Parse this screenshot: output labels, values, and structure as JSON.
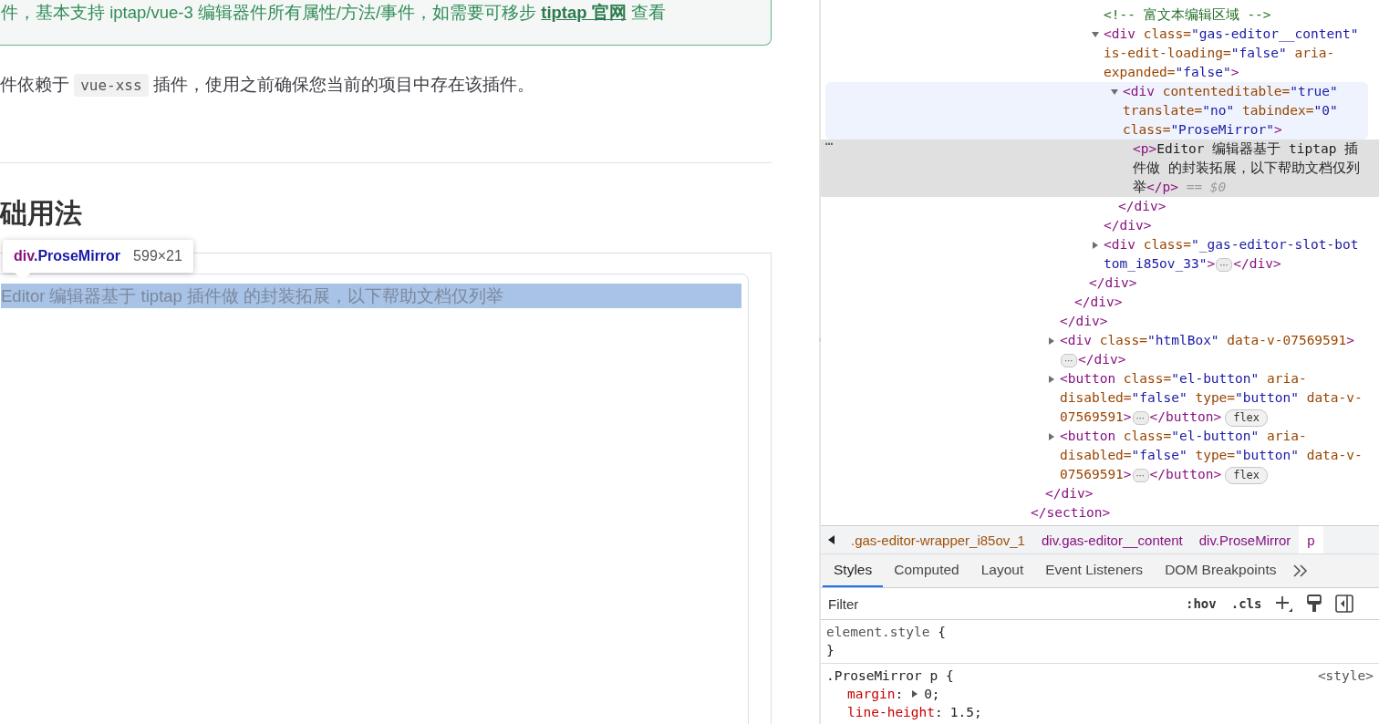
{
  "page": {
    "tip": {
      "text": "件，基本支持 iptap/vue-3 编辑器件所有属性/方法/事件，如需要可移步 ",
      "link": "tiptap 官网",
      "after": " 查看"
    },
    "notice": {
      "before": "件依赖于 ",
      "code": "vue-xss",
      "after": " 插件，使用之前确保您当前的项目中存在该插件。"
    },
    "heading": "础用法",
    "tooltip": {
      "tag": "div",
      "selector": ".ProseMirror",
      "size": "599×21"
    },
    "editor_text": "Editor 编辑器基于 tiptap 插件做 的封装拓展，以下帮助文档仅列举"
  },
  "elements": {
    "close": [
      {
        "kind": "tag",
        "text": "</section>"
      }
    ],
    "children": [
      {
        "close": [
          {
            "kind": "tag",
            "text": "</div>"
          }
        ],
        "children": [
          {
            "close": [
              {
                "kind": "tag",
                "text": "</div>"
              }
            ],
            "children": [
              {
                "close": [
                  {
                    "kind": "tag",
                    "text": "</div>"
                  }
                ],
                "children": [
                  {
                    "close": [
                      {
                        "kind": "tag",
                        "text": "</div>"
                      }
                    ],
                    "children": [
                      {
                        "selected": false,
                        "lines": [
                          [
                            {
                              "kind": "comment",
                              "text": "<!-- 富文本编辑区域 -->"
                            }
                          ]
                        ]
                      },
                      {
                        "expanded": true,
                        "selected": false,
                        "lines": [
                          [
                            {
                              "kind": "tag",
                              "text": "<div"
                            },
                            {
                              "kind": "attr",
                              "text": " class="
                            },
                            {
                              "kind": "value",
                              "text": "\"gas-editor__content\""
                            }
                          ],
                          [
                            {
                              "kind": "attr",
                              "text": "is-edit-loading="
                            },
                            {
                              "kind": "value",
                              "text": "\"false\""
                            },
                            {
                              "kind": "attr",
                              "text": " aria-"
                            }
                          ],
                          [
                            {
                              "kind": "attr",
                              "text": "expanded="
                            },
                            {
                              "kind": "value",
                              "text": "\"false\""
                            },
                            {
                              "kind": "tag",
                              "text": ">"
                            }
                          ]
                        ],
                        "children": [
                          {
                            "expanded": true,
                            "selected": false,
                            "hovered": true,
                            "lines": [
                              [
                                {
                                  "kind": "tag",
                                  "text": "<div"
                                },
                                {
                                  "kind": "attr",
                                  "text": " contenteditable="
                                },
                                {
                                  "kind": "value",
                                  "text": "\"true\""
                                }
                              ],
                              [
                                {
                                  "kind": "attr",
                                  "text": "translate="
                                },
                                {
                                  "kind": "value",
                                  "text": "\"no\""
                                },
                                {
                                  "kind": "attr",
                                  "text": " tabindex="
                                },
                                {
                                  "kind": "value",
                                  "text": "\"0\""
                                }
                              ],
                              [
                                {
                                  "kind": "attr",
                                  "text": "class="
                                },
                                {
                                  "kind": "value",
                                  "text": "\"ProseMirror\""
                                },
                                {
                                  "kind": "tag",
                                  "text": ">"
                                }
                              ]
                            ],
                            "children": [
                              {
                                "selected": true,
                                "more": "⋯",
                                "lines": [
                                  [
                                    {
                                      "kind": "tag",
                                      "text": "<p>"
                                    },
                                    {
                                      "kind": "text",
                                      "text": "Editor 编辑器基于 tiptap 插"
                                    }
                                  ],
                                  [
                                    {
                                      "kind": "text",
                                      "text": "件做 的封装拓展，以下帮助文档仅列"
                                    }
                                  ],
                                  [
                                    {
                                      "kind": "text",
                                      "text": "举"
                                    },
                                    {
                                      "kind": "tag",
                                      "text": "</p>"
                                    },
                                    {
                                      "kind": "eq",
                                      "text": " == $0"
                                    }
                                  ]
                                ]
                              }
                            ],
                            "close": [
                              {
                                "kind": "tag",
                                "text": "</div>"
                              }
                            ]
                          }
                        ],
                        "close": [
                          {
                            "kind": "tag",
                            "text": "</div>"
                          }
                        ]
                      },
                      {
                        "expanded": false,
                        "selected": false,
                        "lines": [
                          [
                            {
                              "kind": "tag",
                              "text": "<div"
                            },
                            {
                              "kind": "attr",
                              "text": " class="
                            },
                            {
                              "kind": "value",
                              "text": "\"_gas-editor-slot-bot"
                            }
                          ],
                          [
                            {
                              "kind": "value",
                              "text": "tom_i85ov_33\""
                            },
                            {
                              "kind": "tag",
                              "text": ">"
                            },
                            {
                              "kind": "ellipsis",
                              "text": "⋯"
                            },
                            {
                              "kind": "tag",
                              "text": "</div>"
                            }
                          ]
                        ]
                      }
                    ]
                  }
                ]
              }
            ]
          },
          {
            "expanded": false,
            "selected": false,
            "lines": [
              [
                {
                  "kind": "tag",
                  "text": "<div"
                },
                {
                  "kind": "attr",
                  "text": " class="
                },
                {
                  "kind": "value",
                  "text": "\"htmlBox\""
                },
                {
                  "kind": "attr",
                  "text": " data-v-07569591"
                },
                {
                  "kind": "tag",
                  "text": ">"
                }
              ],
              [
                {
                  "kind": "ellipsis",
                  "text": "⋯"
                },
                {
                  "kind": "tag",
                  "text": "</div>"
                }
              ]
            ]
          },
          {
            "expanded": false,
            "selected": false,
            "lines": [
              [
                {
                  "kind": "tag",
                  "text": "<button"
                },
                {
                  "kind": "attr",
                  "text": " class="
                },
                {
                  "kind": "value",
                  "text": "\"el-button\""
                },
                {
                  "kind": "attr",
                  "text": " aria-"
                }
              ],
              [
                {
                  "kind": "attr",
                  "text": "disabled="
                },
                {
                  "kind": "value",
                  "text": "\"false\""
                },
                {
                  "kind": "attr",
                  "text": " type="
                },
                {
                  "kind": "value",
                  "text": "\"button\""
                },
                {
                  "kind": "attr",
                  "text": " data-v-"
                }
              ],
              [
                {
                  "kind": "attr",
                  "text": "07569591"
                },
                {
                  "kind": "tag",
                  "text": ">"
                },
                {
                  "kind": "ellipsis",
                  "text": "⋯"
                },
                {
                  "kind": "tag",
                  "text": "</button>"
                },
                {
                  "kind": "badge",
                  "text": "flex"
                }
              ]
            ]
          },
          {
            "expanded": false,
            "selected": false,
            "lines": [
              [
                {
                  "kind": "tag",
                  "text": "<button"
                },
                {
                  "kind": "attr",
                  "text": " class="
                },
                {
                  "kind": "value",
                  "text": "\"el-button\""
                },
                {
                  "kind": "attr",
                  "text": " aria-"
                }
              ],
              [
                {
                  "kind": "attr",
                  "text": "disabled="
                },
                {
                  "kind": "value",
                  "text": "\"false\""
                },
                {
                  "kind": "attr",
                  "text": " type="
                },
                {
                  "kind": "value",
                  "text": "\"button\""
                },
                {
                  "kind": "attr",
                  "text": " data-v-"
                }
              ],
              [
                {
                  "kind": "attr",
                  "text": "07569591"
                },
                {
                  "kind": "tag",
                  "text": ">"
                },
                {
                  "kind": "ellipsis",
                  "text": "⋯"
                },
                {
                  "kind": "tag",
                  "text": "</button>"
                },
                {
                  "kind": "badge",
                  "text": "flex"
                }
              ]
            ]
          }
        ]
      }
    ]
  },
  "breadcrumbs": [
    {
      "label": ".gas-editor-wrapper_i85ov_1",
      "color": "#a0520d",
      "selected": false
    },
    {
      "label": "div.gas-editor__content",
      "color": "#881280",
      "selected": false
    },
    {
      "label": "div.ProseMirror",
      "color": "#881280",
      "selected": false
    },
    {
      "label": "p",
      "color": "#881280",
      "selected": true
    }
  ],
  "tabs": [
    {
      "label": "Styles",
      "selected": true
    },
    {
      "label": "Computed",
      "selected": false
    },
    {
      "label": "Layout",
      "selected": false
    },
    {
      "label": "Event Listeners",
      "selected": false
    },
    {
      "label": "DOM Breakpoints",
      "selected": false
    }
  ],
  "filter": {
    "placeholder": "Filter",
    "hov": ":hov",
    "cls": ".cls"
  },
  "rules": [
    {
      "selector": "element.style",
      "open": "{",
      "close": "}",
      "kind": "inline"
    },
    {
      "selector": ".ProseMirror p",
      "open": "{",
      "source": "<style>",
      "kind": "rule",
      "separator": ":",
      "declarations": [
        {
          "property": "margin",
          "value": "0;",
          "expandable": true
        },
        {
          "property": "line-height",
          "value": "1.5;",
          "expandable": false
        }
      ]
    }
  ]
}
